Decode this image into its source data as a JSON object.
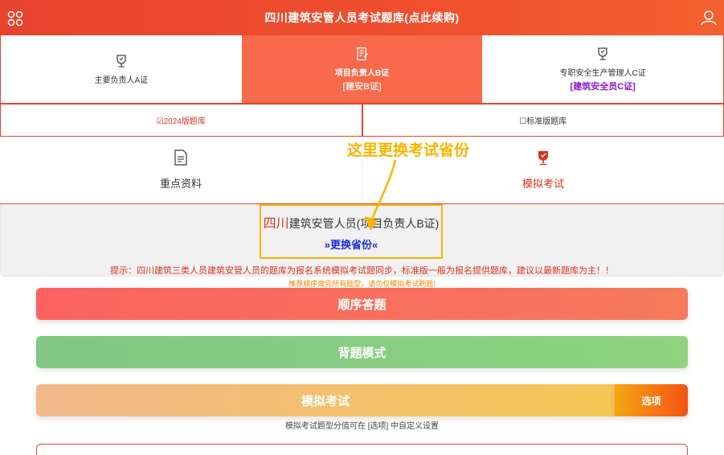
{
  "header": {
    "title": "四川建筑安管人员考试题库(点此续购)",
    "left_icon": "grid-menu-icon",
    "right_icon": "user-icon"
  },
  "cert_tabs": [
    {
      "label": "主要负责人A证",
      "sub": "",
      "icon": "trophy-icon",
      "active": false
    },
    {
      "label": "项目负责人B证",
      "sub": "[建安B证]",
      "icon": "document-edit-icon",
      "active": true
    },
    {
      "label": "专职安全生产管理人C证",
      "sub": "[建筑安全员C证]",
      "icon": "trophy-icon",
      "active": false
    }
  ],
  "versions": {
    "left": "☑2024版题库",
    "right": "☐标准版题库"
  },
  "modes": {
    "left": {
      "label": "重点资料",
      "icon": "document-icon"
    },
    "right": {
      "label": "模拟考试",
      "icon": "trophy-icon"
    }
  },
  "annotation": "这里更换考试省份",
  "province": {
    "name": "四川",
    "text_mid": "建筑安管人员(",
    "text_cert": "项目负责人B证)",
    "change_link": "»更换省份«"
  },
  "tips": {
    "line1": "提示：四川建筑三类人员建筑安管人员的题库为报名系统模拟考试题同步，标准版一般为报名提供题库，建议以最新题库为主！！",
    "line2": "推荐顺序做完所有题型，请勿仅模拟考试刷题!"
  },
  "buttons": {
    "sequential": "顺序答题",
    "recite": "背题模式",
    "mock": "模拟考试",
    "options": "选项"
  },
  "option_note": "模拟考试题型分值可在 [选项] 中自定义设置",
  "colors": {
    "header": "#e8432d",
    "active_tab": "#f9694c",
    "annotation": "#f7b500",
    "link": "#1a2bd6",
    "purple": "#8a1bd6"
  }
}
